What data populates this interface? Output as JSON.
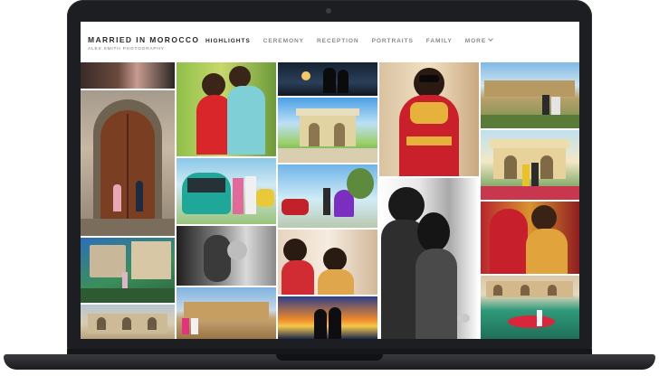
{
  "site": {
    "title": "MARRIED IN MOROCCO",
    "subtitle": "ALEX SMITH PHOTOGRAPHY"
  },
  "nav": {
    "items": [
      {
        "label": "HIGHLIGHTS",
        "active": true
      },
      {
        "label": "CEREMONY",
        "active": false
      },
      {
        "label": "RECEPTION",
        "active": false
      },
      {
        "label": "PORTRAITS",
        "active": false
      },
      {
        "label": "FAMILY",
        "active": false
      },
      {
        "label": "MORE",
        "active": false
      }
    ]
  },
  "icons": {
    "more_dropdown": "chevron-down-icon",
    "webcam": "camera-dot"
  },
  "colors": {
    "bezel": "#1d1e21",
    "nav_active": "#2b2b2b",
    "nav_inactive": "#8a8a8a",
    "accent_red": "#c4232c"
  }
}
